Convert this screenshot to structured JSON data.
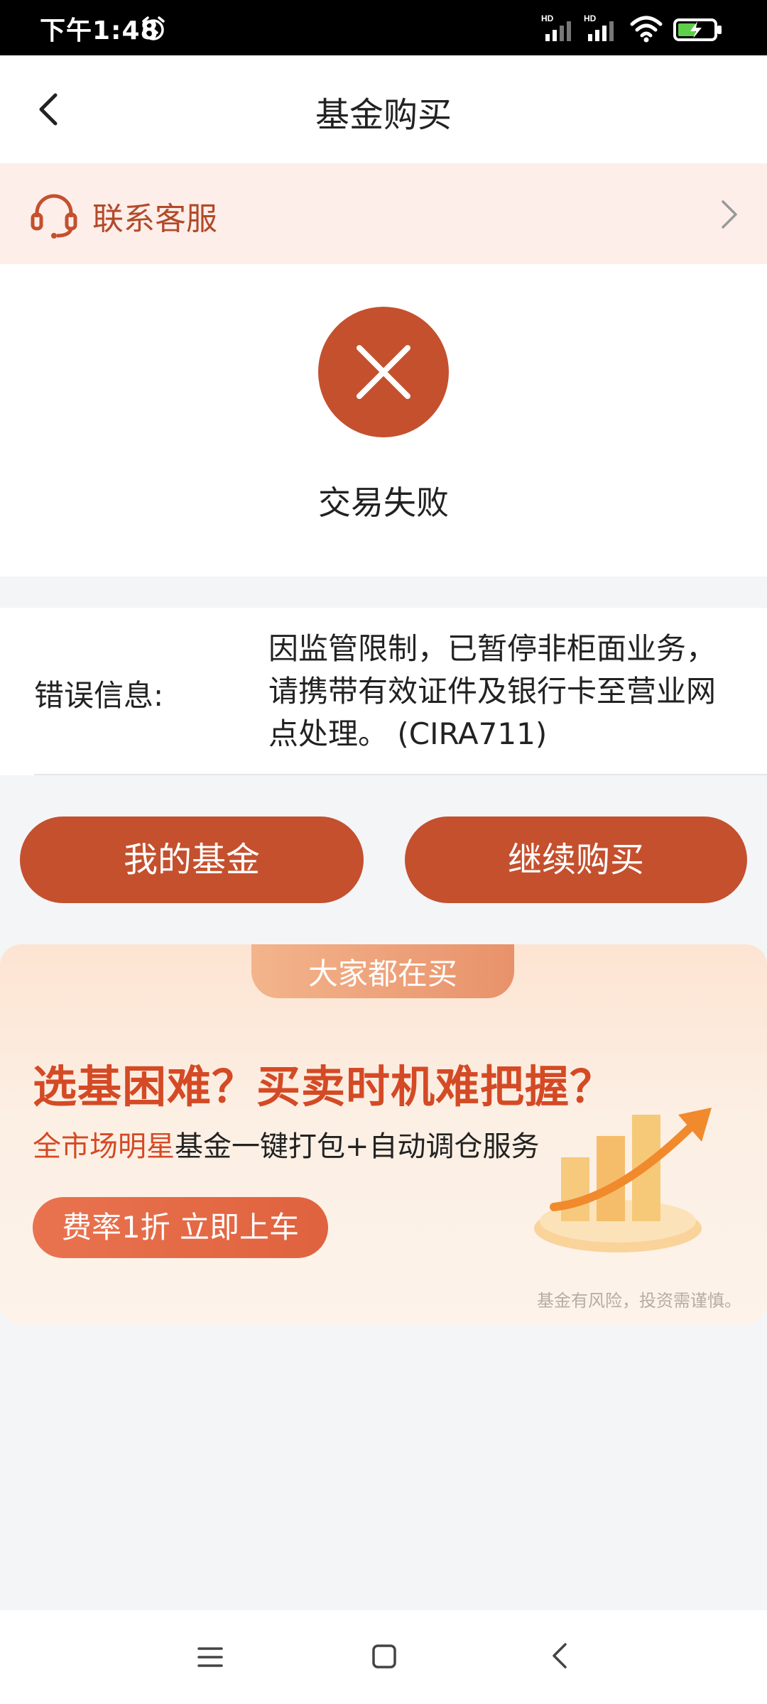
{
  "status_bar": {
    "time": "下午1:48",
    "signal_label_1": "HD",
    "signal_label_2": "HD",
    "icons": [
      "alarm-icon",
      "signal-icon",
      "signal-icon",
      "wifi-icon",
      "battery-charging-icon"
    ]
  },
  "header": {
    "title": "基金购买",
    "back_icon": "back-arrow-icon"
  },
  "service": {
    "label": "联系客服",
    "icon": "headset-icon",
    "chevron": "chevron-right-icon"
  },
  "result": {
    "status_icon": "close-icon",
    "status_text": "交易失败"
  },
  "error": {
    "label": "错误信息:",
    "message": "因监管限制，已暂停非柜面业务，请携带有效证件及银行卡至营业网点处理。 (CIRA711)"
  },
  "buttons": {
    "my_fund": "我的基金",
    "continue_buy": "继续购买"
  },
  "banner": {
    "tag": "大家都在买",
    "headline": "选基困难？买卖时机难把握？",
    "sub_highlight": "全市场明星",
    "sub_rest": "基金一键打包+自动调仓服务",
    "cta": "费率1折 立即上车",
    "disclaimer": "基金有风险，投资需谨慎。"
  },
  "nav_bar": {
    "icons": [
      "menu-icon",
      "home-icon",
      "back-icon"
    ]
  },
  "colors": {
    "accent": "#c4502e",
    "service_bg": "#fdeee9",
    "page_bg": "#f4f5f7"
  }
}
